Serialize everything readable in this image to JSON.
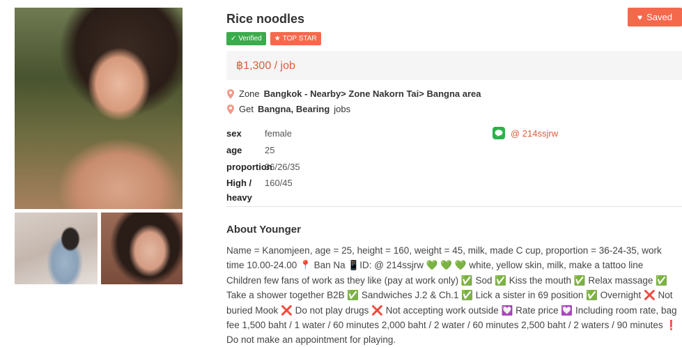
{
  "listing": {
    "title": "Rice noodles",
    "saved_label": "Saved",
    "badges": {
      "verified": "Verified",
      "top_star": "TOP STAR"
    },
    "price": "฿1,300 / job",
    "zone_prefix": "Zone",
    "zone_value": "Bangkok - Nearby> Zone Nakorn Tai> Bangna area",
    "get_prefix": "Get",
    "get_value": "Bangna, Bearing",
    "get_suffix": "jobs",
    "line_id": "@ 214ssjrw"
  },
  "specs": {
    "sex_label": "sex",
    "sex_value": "female",
    "age_label": "age",
    "age_value": "25",
    "proportion_label": "proportion",
    "proportion_value": "36/26/35",
    "height_label_1": "High /",
    "height_label_2": "heavy",
    "height_value": "160/45"
  },
  "about": {
    "title": "About Younger",
    "text": "Name = Kanomjeen, age = 25, height = 160, weight = 45, milk, made C cup, proportion = 36-24-35, work time 10.00-24.00 📍 Ban Na 📱ID: @ 214ssjrw 💚 💚 💚 white, yellow skin, milk, make a tattoo line Children few fans of work as they like (pay at work only) ✅ Sod ✅ Kiss the mouth ✅ Relax massage ✅ Take a shower together B2B ✅ Sandwiches J.2 & Ch.1 ✅ Lick a sister in 69 position ✅ Overnight ❌ Not buried Mook ❌ Do not play drugs ❌ Not accepting work outside 💟 Rate price 💟 Including room rate, bag fee 1,500 baht / 1 water / 60 minutes 2,000 baht / 2 water / 60 minutes 2,500 baht / 2 waters / 90 minutes ❗ Do not make an appointment for playing."
  },
  "colors": {
    "accent": "#f4694c",
    "price": "#e05a3a",
    "verified": "#3bab4b",
    "line": "#2bb24c"
  },
  "icons": {
    "saved": "heart-icon",
    "verified": "check-icon",
    "top_star": "star-icon",
    "location": "map-pin-icon",
    "line": "line-app-icon"
  }
}
